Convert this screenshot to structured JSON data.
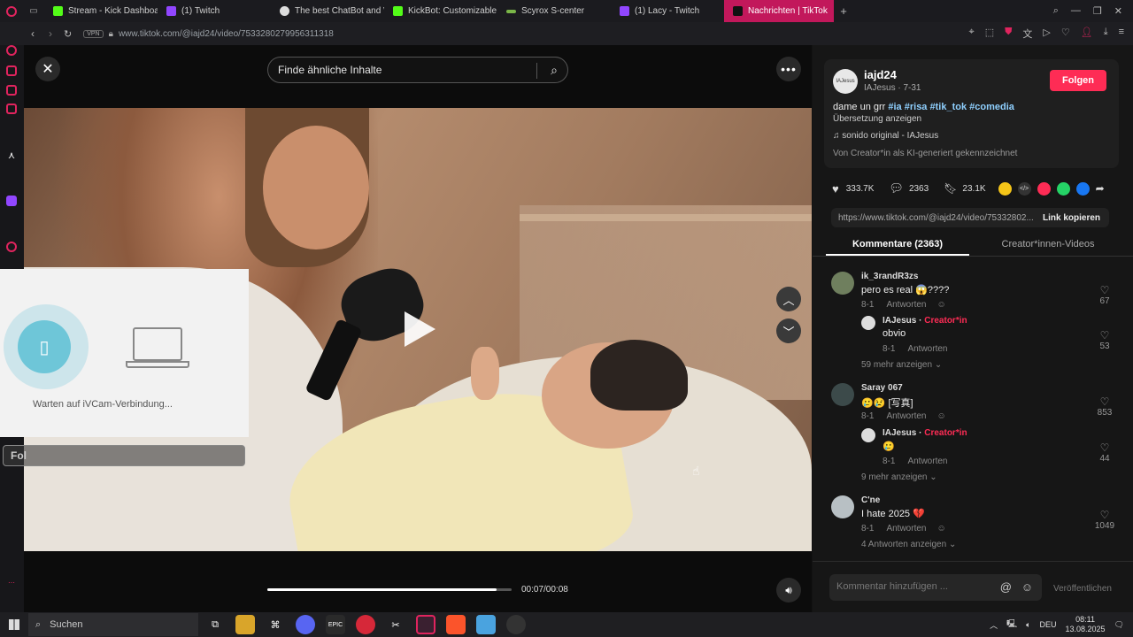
{
  "tabs": [
    {
      "label": "Stream - Kick Dashboard",
      "color": "#53fc18"
    },
    {
      "label": "(1) Twitch",
      "color": "#9146ff"
    },
    {
      "label": "The best ChatBot and Wi",
      "color": "#ffffff"
    },
    {
      "label": "KickBot: Customizable C",
      "color": "#53fc18"
    },
    {
      "label": "Scyrox S-center",
      "color": "#7ab648"
    },
    {
      "label": "(1) Lacy - Twitch",
      "color": "#9146ff"
    },
    {
      "label": "Nachrichten | TikTok",
      "color": "#ffffff"
    }
  ],
  "address": {
    "vpn": "VPN",
    "url": "www.tiktok.com/@iajd24/video/7533280279956311318"
  },
  "viewer": {
    "search_placeholder": "Finde ähnliche Inhalte",
    "time": "00:07/00:08",
    "progress": 0.94,
    "ivcam_text": "Warten auf iVCam-Verbindung...",
    "follow_ghost": "Fol"
  },
  "author": {
    "username": "iajd24",
    "avatar_text": "IAJesus",
    "subline": "IAJesus · 7-31",
    "follow": "Folgen",
    "caption_text": "dame un grr",
    "hashtags": [
      "#ia",
      "#risa",
      "#tik_tok",
      "#comedia"
    ],
    "translate": "Übersetzung anzeigen",
    "sound": "sonido original - IAJesus",
    "ai_label": "Von Creator*in als KI-generiert gekennzeichnet"
  },
  "stats": {
    "likes": "333.7K",
    "comments": "2363",
    "saves": "23.1K"
  },
  "share": {
    "link": "https://www.tiktok.com/@iajd24/video/75332802...",
    "copy": "Link kopieren"
  },
  "tabs_right": {
    "comments": "Kommentare (2363)",
    "videos": "Creator*innen-Videos"
  },
  "comments": [
    {
      "user": "ik_3randR3zs",
      "text": "pero es real 😱????",
      "date": "8-1",
      "reply": "Antworten",
      "likes": "67",
      "sub": {
        "user": "IAJesus",
        "badge": "Creator*in",
        "text": "obvio",
        "date": "8-1",
        "reply": "Antworten",
        "likes": "53"
      },
      "more": "59 mehr anzeigen"
    },
    {
      "user": "Saray 067",
      "text": "🥲😢 [写真]",
      "date": "8-1",
      "reply": "Antworten",
      "likes": "853",
      "sub": {
        "user": "IAJesus",
        "badge": "Creator*in",
        "text": "🥲",
        "date": "8-1",
        "reply": "Antworten",
        "likes": "44"
      },
      "more": "9 mehr anzeigen"
    },
    {
      "user": "C'ne",
      "text": "I hate 2025 💔",
      "date": "8-1",
      "reply": "Antworten",
      "likes": "1049",
      "more": "4 Antworten anzeigen"
    }
  ],
  "composer": {
    "placeholder": "Kommentar hinzufügen ...",
    "post": "Veröffentlichen"
  },
  "taskbar": {
    "search": "Suchen",
    "lang": "DEU",
    "time": "08:11",
    "date": "13.08.2025"
  },
  "colors": {
    "accent": "#fe2c55",
    "hashtag": "#8fd0ff",
    "creator": "#fe2c55"
  }
}
